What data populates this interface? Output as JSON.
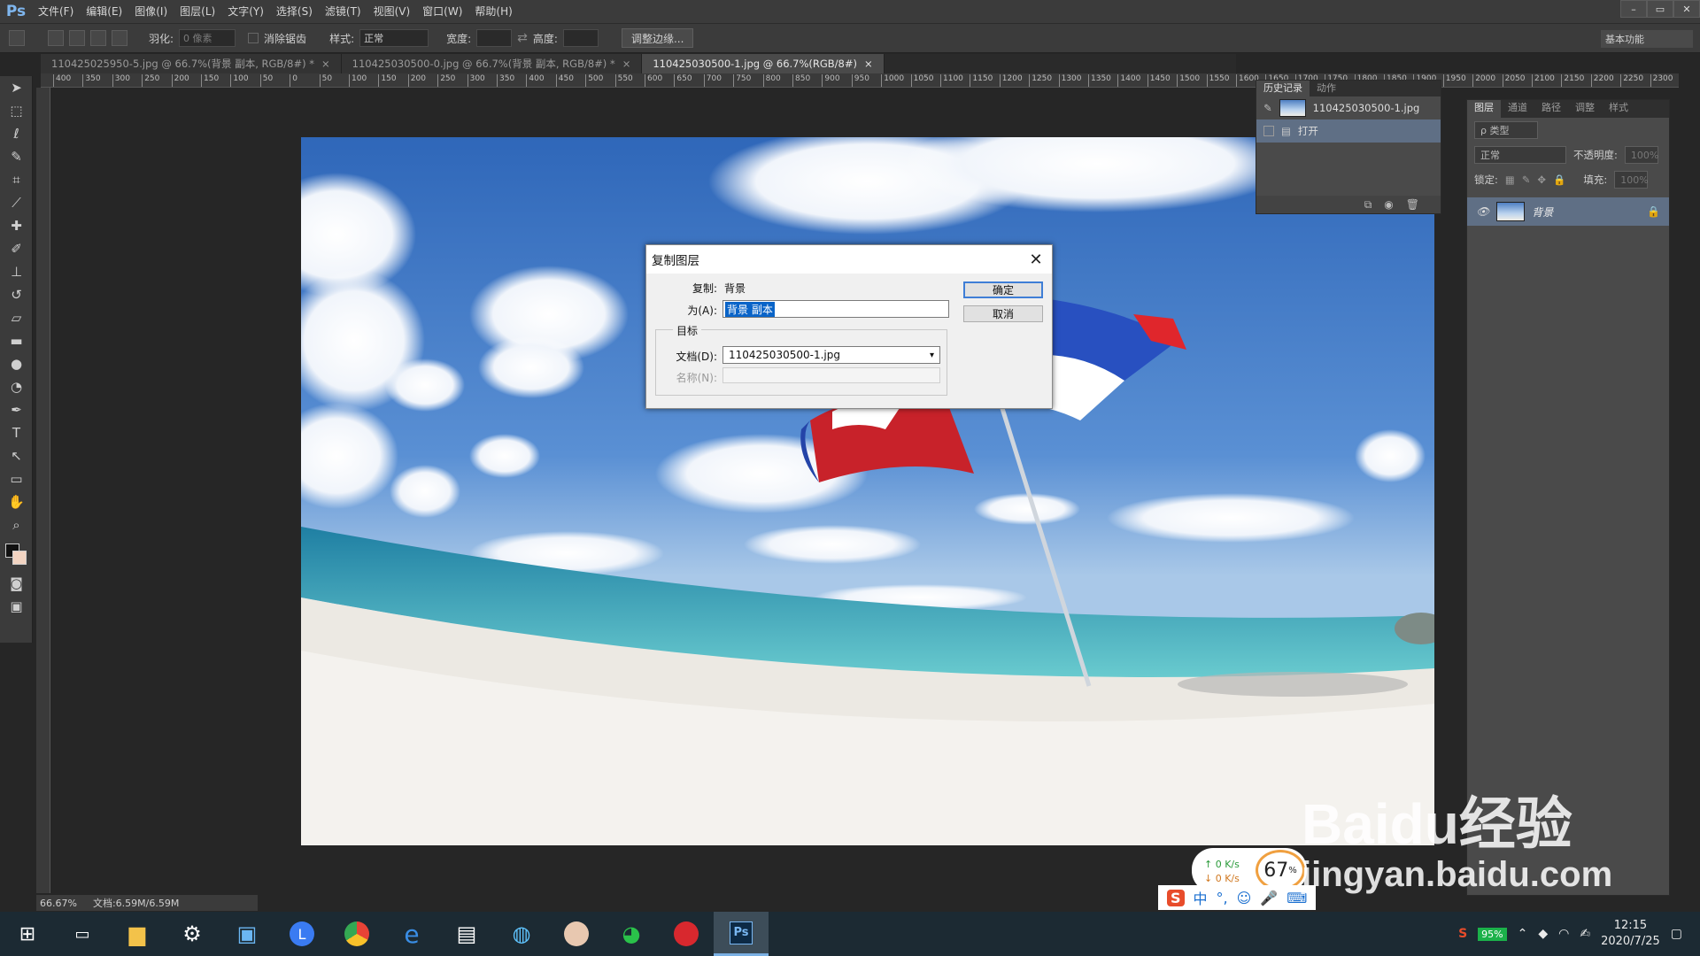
{
  "app": {
    "logo": "Ps",
    "menu": [
      "文件(F)",
      "编辑(E)",
      "图像(I)",
      "图层(L)",
      "文字(Y)",
      "选择(S)",
      "滤镜(T)",
      "视图(V)",
      "窗口(W)",
      "帮助(H)"
    ],
    "window_controls": [
      "–",
      "▭",
      "✕"
    ]
  },
  "options_bar": {
    "feather_label": "羽化:",
    "feather_value": "0 像素",
    "antialias_label": "消除锯齿",
    "style_label": "样式:",
    "style_value": "正常",
    "width_label": "宽度:",
    "height_label": "高度:",
    "refine_edge": "调整边缘...",
    "workspace": "基本功能"
  },
  "tabs": [
    {
      "label": "110425025950-5.jpg @ 66.7%(背景 副本, RGB/8#) *",
      "close": "×"
    },
    {
      "label": "110425030500-0.jpg @ 66.7%(背景 副本, RGB/8#) *",
      "close": "×"
    },
    {
      "label": "110425030500-1.jpg @ 66.7%(RGB/8#)",
      "close": "×"
    }
  ],
  "ruler_h": [
    "400",
    "350",
    "300",
    "250",
    "200",
    "150",
    "100",
    "50",
    "0",
    "50",
    "100",
    "150",
    "200",
    "250",
    "300",
    "350",
    "400",
    "450",
    "500",
    "550",
    "600",
    "650",
    "700",
    "750",
    "800",
    "850",
    "900",
    "950",
    "1000",
    "1050",
    "1100",
    "1150",
    "1200",
    "1250",
    "1300",
    "1350",
    "1400",
    "1450",
    "1500",
    "1550",
    "1600",
    "1650",
    "1700",
    "1750",
    "1800",
    "1850",
    "1900",
    "1950",
    "2000",
    "2050",
    "2100",
    "2150",
    "2200",
    "2250",
    "2300"
  ],
  "history_panel": {
    "tabs": [
      "历史记录",
      "动作"
    ],
    "snapshot": "110425030500-1.jpg",
    "state": "打开"
  },
  "layers_panel": {
    "tabs": [
      "图层",
      "通道",
      "路径",
      "调整",
      "样式"
    ],
    "kind_filter": "ρ 类型",
    "blend_mode": "正常",
    "opacity_label": "不透明度:",
    "opacity_value": "100%",
    "lock_label": "锁定:",
    "fill_label": "填充:",
    "fill_value": "100%",
    "layer_name": "背景"
  },
  "status": {
    "zoom": "66.67%",
    "doc": "文档:6.59M/6.59M"
  },
  "dialog": {
    "title": "复制图层",
    "copy_label": "复制:",
    "copy_value": "背景",
    "as_label": "为(A):",
    "as_value": "背景 副本",
    "target_group": "目标",
    "document_label": "文档(D):",
    "document_value": "110425030500-1.jpg",
    "name_label": "名称(N):",
    "ok": "确定",
    "cancel": "取消"
  },
  "net_widget": {
    "up": "0 K/s",
    "down": "0 K/s",
    "percent": "67",
    "unit": "%"
  },
  "ime": [
    "中",
    "°,",
    "☺",
    "🎤",
    "⌨"
  ],
  "tray": {
    "battery": "95%",
    "time": "12:15",
    "date": "2020/7/25"
  },
  "watermark": {
    "brand": "Baidu经验",
    "url": "jingyan.baidu.com"
  }
}
